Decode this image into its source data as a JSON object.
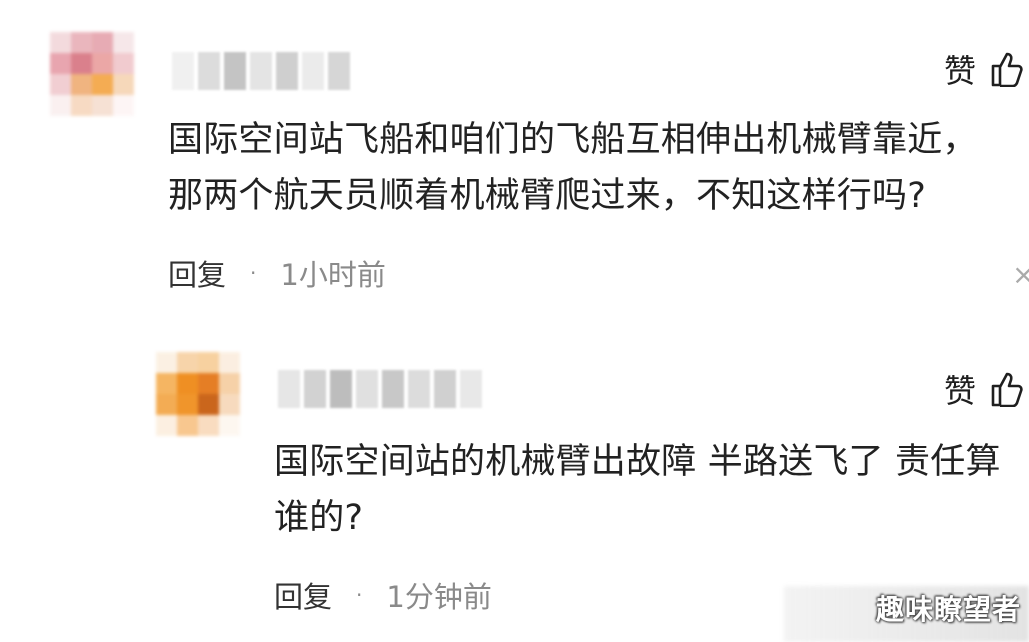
{
  "comments": [
    {
      "text": "国际空间站飞船和咱们的飞船互相伸出机械臂靠近，\n那两个航天员顺着机械臂爬过来，不知这样行吗?",
      "like_label": "赞",
      "reply_label": "回复",
      "separator": "·",
      "time": "1小时前"
    },
    {
      "text": "国际空间站的机械臂出故障 半路送飞了 责任算\n谁的?",
      "like_label": "赞",
      "reply_label": "回复",
      "separator": "·",
      "time": "1分钟前"
    }
  ],
  "close_glyph": "×",
  "watermark": "趣味瞭望者",
  "colors": {
    "text": "#222222",
    "muted": "#8a8a8a",
    "background": "#ffffff"
  },
  "icons": [
    "thumb-up-icon",
    "close-icon"
  ]
}
